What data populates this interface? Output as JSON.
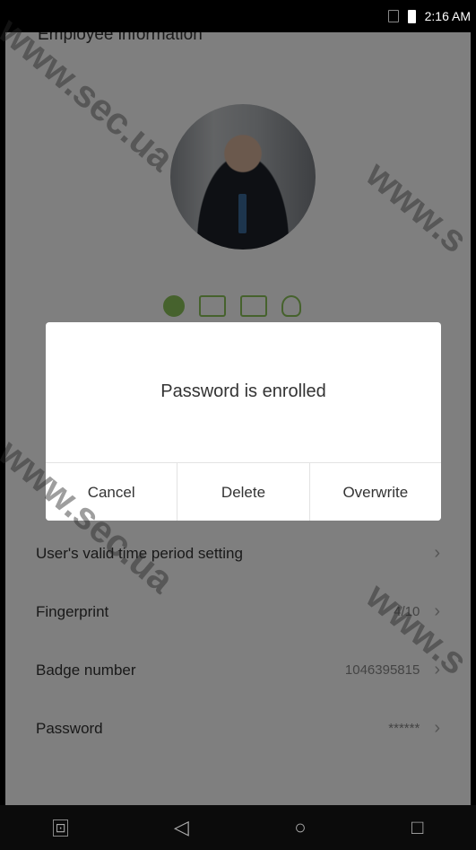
{
  "status_bar": {
    "time": "2:16 AM"
  },
  "header": {
    "title": "Employee information"
  },
  "enroll_icons": [
    "fingerprint-icon",
    "card-icon",
    "password-icon",
    "face-icon"
  ],
  "settings": [
    {
      "label": "User's valid time period setting",
      "value": ""
    },
    {
      "label": "Fingerprint",
      "value": "4/10"
    },
    {
      "label": "Badge number",
      "value": "1046395815"
    },
    {
      "label": "Password",
      "value": "******"
    }
  ],
  "dialog": {
    "message": "Password is enrolled",
    "buttons": {
      "cancel": "Cancel",
      "delete": "Delete",
      "overwrite": "Overwrite"
    }
  },
  "watermark": {
    "text_left": "www.sec.ua",
    "text_right": "www.s"
  },
  "colors": {
    "accent": "#8cc45a",
    "overlay": "rgba(0,0,0,0.5)"
  }
}
